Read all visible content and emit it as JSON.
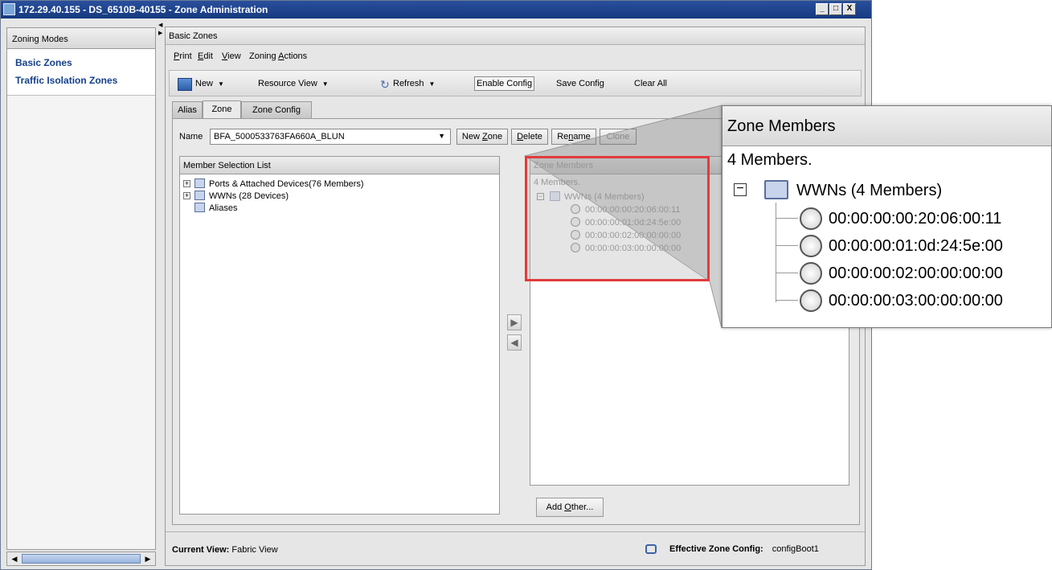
{
  "window": {
    "title": "172.29.40.155 - DS_6510B-40155 - Zone Administration",
    "min": "_",
    "max": "□",
    "close": "X"
  },
  "left_panel": {
    "header": "Zoning Modes",
    "modes": [
      "Basic Zones",
      "Traffic Isolation Zones"
    ]
  },
  "main": {
    "header": "Basic Zones",
    "menu": [
      {
        "label": "Print",
        "accel": "P"
      },
      {
        "label": "Edit",
        "accel": "E"
      },
      {
        "label": "View",
        "accel": "V"
      },
      {
        "label": "Zoning Actions",
        "accel": "A"
      }
    ],
    "toolbar": {
      "new": "New",
      "resource_view": "Resource View",
      "refresh": "Refresh",
      "enable_config": "Enable Config",
      "save_config": "Save Config",
      "clear_all": "Clear All"
    },
    "tabs": [
      "Alias",
      "Zone",
      "Zone Config"
    ],
    "active_tab": "Zone",
    "name_label": "Name",
    "name_value": "BFA_5000533763FA660A_BLUN",
    "buttons": {
      "new_zone": "New Zone",
      "delete": "Delete",
      "rename": "Rename",
      "clone": "Clone",
      "add_other": "Add Other..."
    },
    "member_selection": {
      "title": "Member Selection List",
      "items": [
        {
          "label": "Ports & Attached Devices(76 Members)",
          "expand": "+"
        },
        {
          "label": "WWNs (28 Devices)",
          "expand": "+"
        },
        {
          "label": "Aliases",
          "expand": ""
        }
      ]
    },
    "zone_members": {
      "title": "Zone Members",
      "count": "4 Members.",
      "group": "WWNs (4 Members)",
      "group_expand": "−",
      "members": [
        "00:00:00:00:20:06:00:11",
        "00:00:00:01:0d:24:5e:00",
        "00:00:00:02:00:00:00:00",
        "00:00:00:03:00:00:00:00"
      ]
    },
    "status": {
      "current_view_label": "Current View:",
      "current_view_value": "Fabric View",
      "effective_label": "Effective Zone Config:",
      "effective_value": "configBoot1"
    }
  },
  "zoom_callout": {
    "title": "Zone Members",
    "count": "4 Members.",
    "group": "WWNs (4 Members)",
    "group_expand": "−",
    "members": [
      "00:00:00:00:20:06:00:11",
      "00:00:00:01:0d:24:5e:00",
      "00:00:00:02:00:00:00:00",
      "00:00:00:03:00:00:00:00"
    ],
    "highlight_color": "#e23b3b"
  }
}
